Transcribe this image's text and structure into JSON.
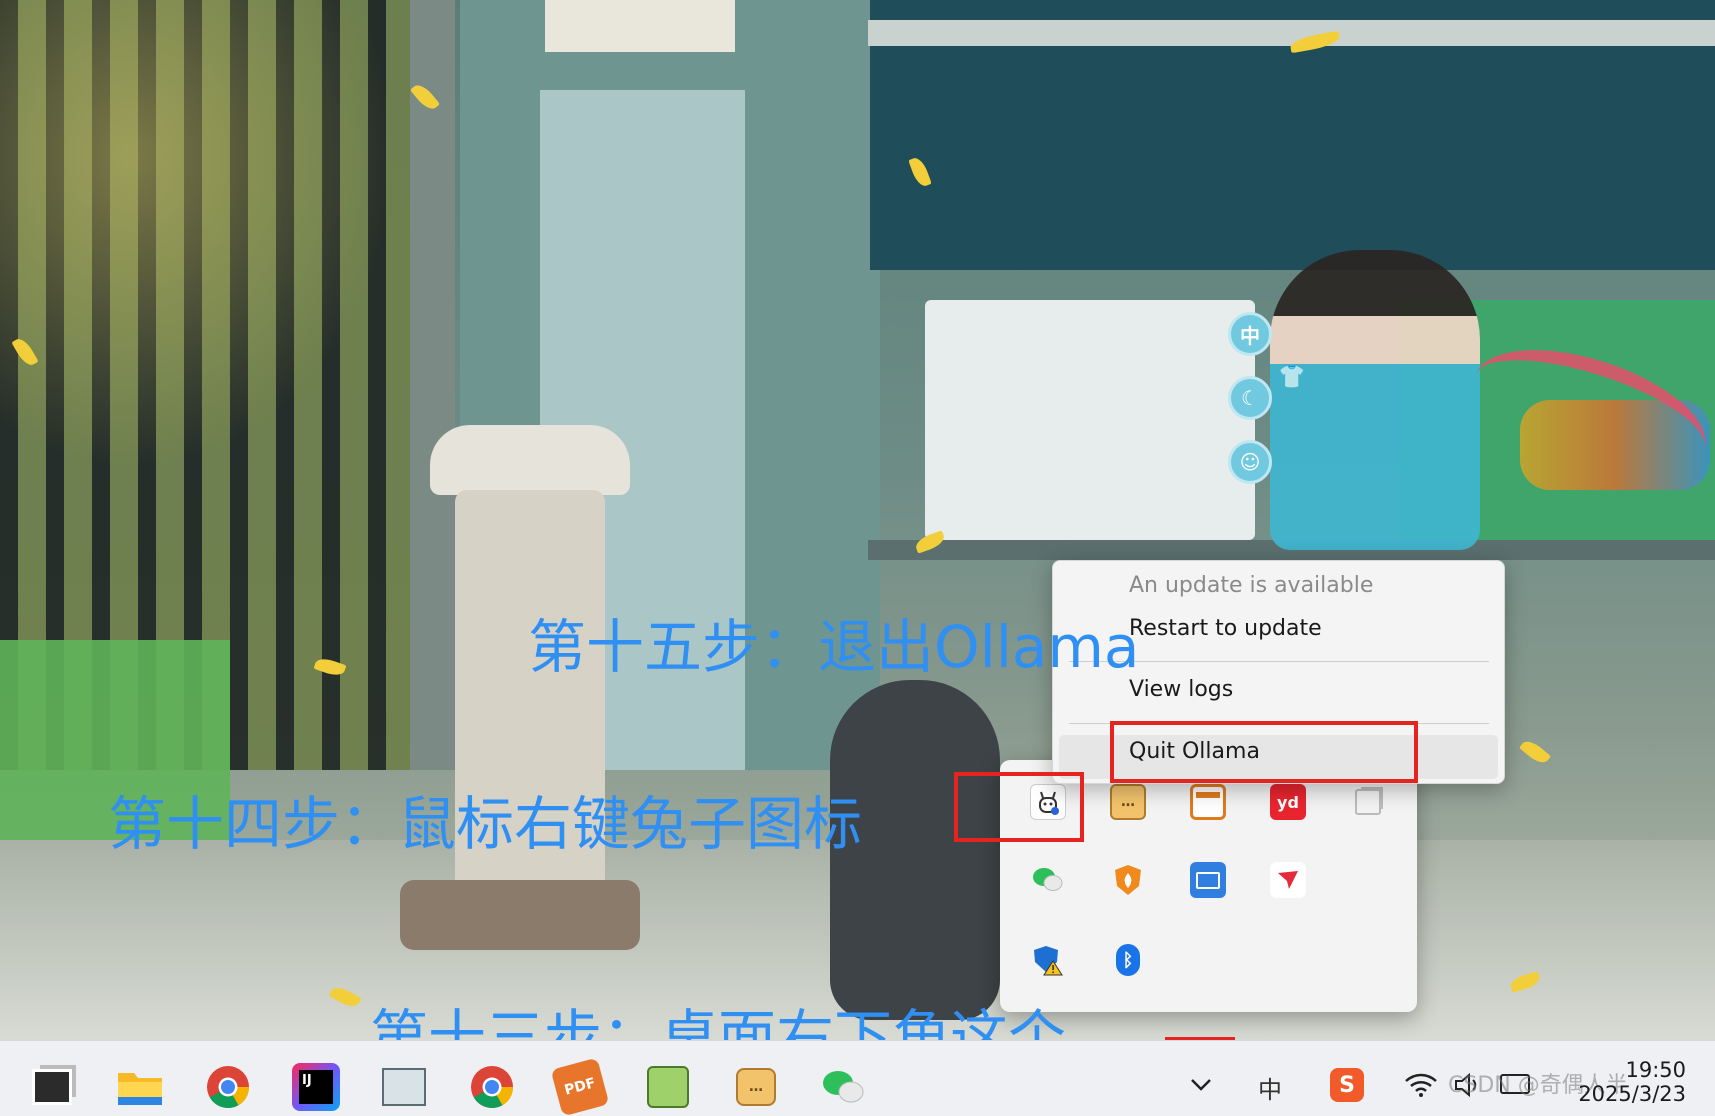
{
  "annotations": {
    "step13": "第十三步：桌面右下角这个",
    "step14": "第十四步：鼠标右键兔子图标",
    "step15": "第十五步：退出Ollama"
  },
  "context_menu": {
    "status": "An update is available",
    "restart": "Restart to update",
    "view_logs": "View logs",
    "quit": "Quit Ollama"
  },
  "ime_toolbar": {
    "lang_label": "中"
  },
  "tray_flyout": {
    "icons": [
      "ollama-llama-icon",
      "chat-bubble-icon",
      "video-player-icon",
      "youdao-icon",
      "copy-icon",
      "wechat-icon",
      "huorong-security-icon",
      "remote-desktop-icon",
      "feishu-icon",
      "windows-security-warning-icon",
      "bluetooth-icon"
    ],
    "youdao_label": "yd"
  },
  "taskbar": {
    "pdf_label": "PDF",
    "ime_label": "中",
    "sogou_label": "S",
    "jetbrains_label": "IJ"
  },
  "clock": {
    "time": "19:50",
    "date": "2025/3/23"
  },
  "watermark": "CSDN @奇偶人半",
  "colors": {
    "annotation_text": "#2f8ff2",
    "highlight_box": "#e5231f",
    "menu_background": "#f4f4f4"
  }
}
